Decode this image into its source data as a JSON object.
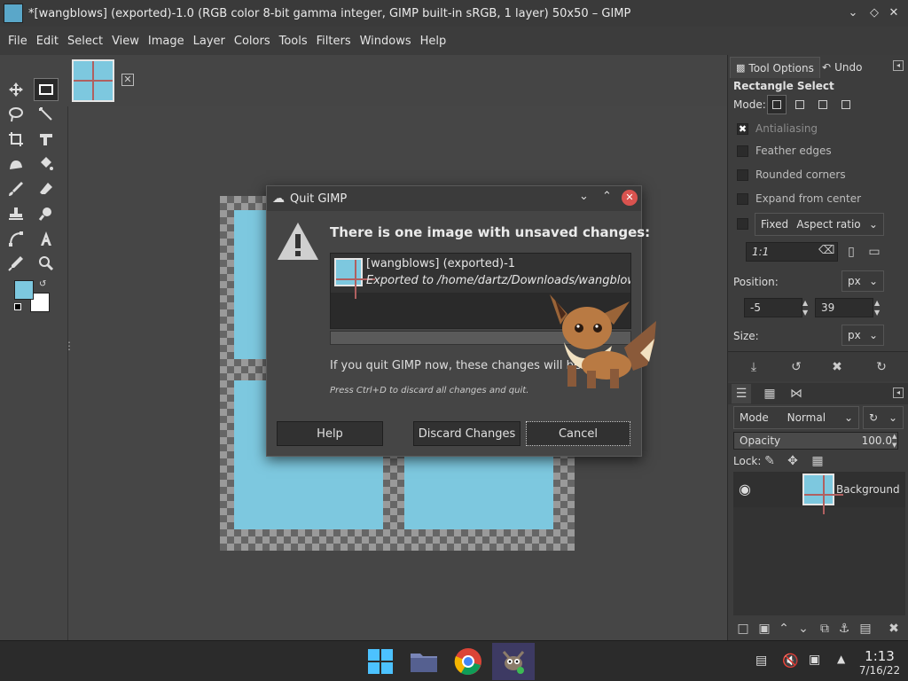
{
  "window": {
    "title": "*[wangblows] (exported)-1.0 (RGB color 8-bit gamma integer, GIMP built-in sRGB, 1 layer) 50x50 – GIMP"
  },
  "menu": [
    "File",
    "Edit",
    "Select",
    "View",
    "Image",
    "Layer",
    "Colors",
    "Tools",
    "Filters",
    "Windows",
    "Help"
  ],
  "colors": {
    "foreground": "#7dc8df",
    "background": "#ffffff"
  },
  "tool_options": {
    "tabs": [
      "Tool Options",
      "Undo"
    ],
    "heading": "Rectangle Select",
    "mode_label": "Mode:",
    "antialiasing": "Antialiasing",
    "feather": "Feather edges",
    "rounded": "Rounded corners",
    "expand": "Expand from center",
    "fixed": "Fixed",
    "aspect": "Aspect ratio",
    "ratio_value": "1:1",
    "position_label": "Position:",
    "position_unit": "px",
    "pos_x": "-5",
    "pos_y": "39",
    "size_label": "Size:",
    "size_unit": "px"
  },
  "layers": {
    "mode_label": "Mode",
    "mode_value": "Normal",
    "opacity_label": "Opacity",
    "opacity_value": "100.0",
    "lock_label": "Lock:",
    "layer_name": "Background"
  },
  "dialog": {
    "title": "Quit GIMP",
    "heading": "There is one image with unsaved changes:",
    "item_name": "[wangblows] (exported)-1",
    "item_path": "Exported to /home/dartz/Downloads/wangblows.p",
    "message": "If you quit GIMP now, these changes will be",
    "hint": "Press Ctrl+D to discard all changes and quit.",
    "help": "Help",
    "discard": "Discard Changes",
    "cancel": "Cancel"
  },
  "taskbar": {
    "time": "1:13",
    "date": "7/16/22"
  }
}
